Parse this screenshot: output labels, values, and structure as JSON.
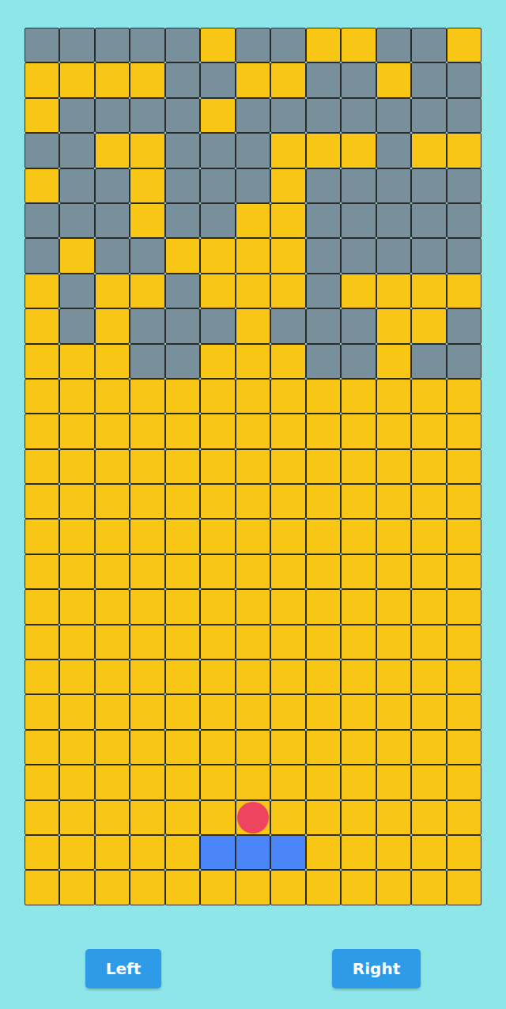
{
  "grid": {
    "rows": 25,
    "cols": 13
  },
  "bricks": [
    [
      true,
      true,
      true,
      true,
      true,
      false,
      true,
      true,
      false,
      false,
      true,
      true,
      false
    ],
    [
      false,
      false,
      false,
      false,
      true,
      true,
      false,
      false,
      true,
      true,
      false,
      true,
      true
    ],
    [
      false,
      true,
      true,
      true,
      true,
      false,
      true,
      true,
      true,
      true,
      true,
      true,
      true
    ],
    [
      true,
      true,
      false,
      false,
      true,
      true,
      true,
      false,
      false,
      false,
      true,
      false,
      false
    ],
    [
      false,
      true,
      true,
      false,
      true,
      true,
      true,
      false,
      true,
      true,
      true,
      true,
      true
    ],
    [
      true,
      true,
      true,
      false,
      true,
      true,
      false,
      false,
      true,
      true,
      true,
      true,
      true
    ],
    [
      true,
      false,
      true,
      true,
      false,
      false,
      false,
      false,
      true,
      true,
      true,
      true,
      true
    ],
    [
      false,
      true,
      false,
      false,
      true,
      false,
      false,
      false,
      true,
      false,
      false,
      false,
      false
    ],
    [
      false,
      true,
      false,
      true,
      true,
      true,
      false,
      true,
      true,
      true,
      false,
      false,
      true
    ],
    [
      false,
      false,
      false,
      true,
      true,
      false,
      false,
      false,
      true,
      true,
      false,
      true,
      true
    ]
  ],
  "paddle": {
    "row": 23,
    "cols": [
      5,
      6,
      7
    ]
  },
  "ball": {
    "row": 22,
    "col": 6
  },
  "buttons": [
    "Left",
    "Right"
  ]
}
